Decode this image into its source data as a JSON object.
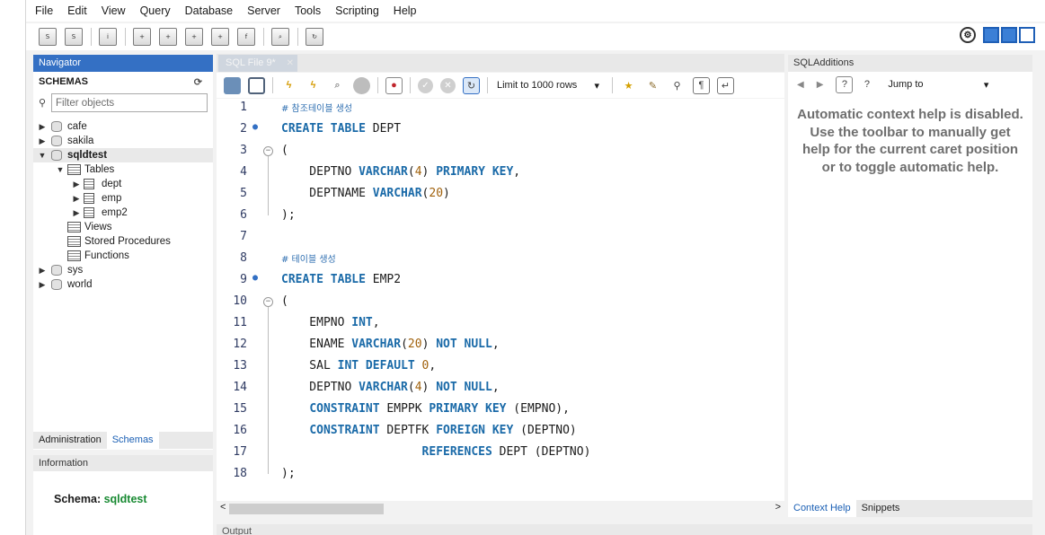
{
  "menu": [
    "File",
    "Edit",
    "View",
    "Query",
    "Database",
    "Server",
    "Tools",
    "Scripting",
    "Help"
  ],
  "navigator": {
    "title": "Navigator",
    "schemas_label": "SCHEMAS",
    "filter_placeholder": "Filter objects",
    "tree": {
      "cafe": "cafe",
      "sakila": "sakila",
      "sqldtest": "sqldtest",
      "tables": "Tables",
      "dept": "dept",
      "emp": "emp",
      "emp2": "emp2",
      "views": "Views",
      "procs": "Stored Procedures",
      "functions": "Functions",
      "sys": "sys",
      "world": "world"
    },
    "tabs": [
      "Administration",
      "Schemas"
    ]
  },
  "information": {
    "title": "Information",
    "schema_label": "Schema:",
    "schema_value": "sqldtest"
  },
  "editor": {
    "tab_title": "SQL File 9*",
    "limit_label": "Limit to 1000 rows",
    "line_numbers": [
      "1",
      "2",
      "3",
      "4",
      "5",
      "6",
      "7",
      "8",
      "9",
      "10",
      "11",
      "12",
      "13",
      "14",
      "15",
      "16",
      "17",
      "18"
    ]
  },
  "additions": {
    "title": "SQLAdditions",
    "jump_label": "Jump to",
    "help_text": "Automatic context help is disabled. Use the toolbar to manually get help for the current caret position or to toggle automatic help.",
    "tabs": [
      "Context Help",
      "Snippets"
    ]
  },
  "output": {
    "title": "Output"
  },
  "colors": {
    "keyword": "#1a6aa8",
    "number": "#a0610c",
    "comment": "#2f6fb1",
    "navigator_header": "#3470c4",
    "schema_value": "#188a32"
  }
}
